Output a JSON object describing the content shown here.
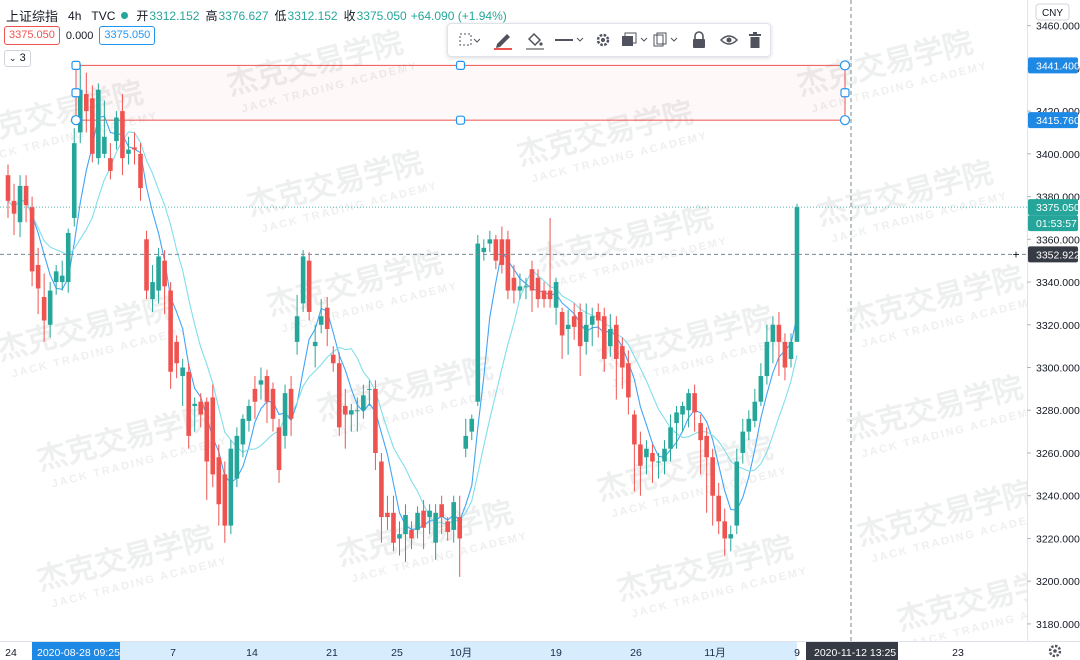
{
  "header": {
    "symbol": "上证综指",
    "interval": "4h",
    "source": "TVC",
    "open_label": "开",
    "open": "3312.152",
    "high_label": "高",
    "high": "3376.627",
    "low_label": "低",
    "low": "3312.152",
    "close_label": "收",
    "close": "3375.050",
    "change": "+64.090 (+1.94%)",
    "price_box": "3375.050",
    "zero_value": "0.000",
    "ma_box": "3375.050",
    "collapse_label": "3"
  },
  "currency": "CNY",
  "y_ticks": [
    "3460.000",
    "3440.000",
    "3420.000",
    "3400.000",
    "3380.000",
    "3360.000",
    "3340.000",
    "3320.000",
    "3300.000",
    "3280.000",
    "3260.000",
    "3240.000",
    "3220.000",
    "3200.000",
    "3180.000"
  ],
  "price_labels": {
    "rect_top": "3441.400",
    "rect_bottom": "3415.760",
    "last_price": "3375.050",
    "countdown": "01:53:57",
    "crosshair_price": "3352.922",
    "crosshair_plus": "+"
  },
  "x_ticks": [
    "24",
    "7",
    "14",
    "21",
    "25",
    "10月",
    "19",
    "26",
    "11月",
    "9",
    "23"
  ],
  "time_labels": {
    "left_date": "2020-08-28",
    "left_time": "09:25",
    "right_date": "2020-11-12",
    "right_time": "13:25"
  },
  "watermark": {
    "cn": "杰克交易学院",
    "en": "JACK TRADING ACADEMY"
  },
  "colors": {
    "up": "#26a69a",
    "down": "#ef5350",
    "ma_fast": "#42a5f5",
    "ma_slow": "#80deea",
    "rect": "#ef5350",
    "accent": "#2196f3"
  },
  "toolbar": {
    "icons": [
      "dashed-square-icon",
      "pencil-icon",
      "paint-bucket-icon",
      "line-style-icon",
      "gear-icon",
      "layers-icon",
      "copy-icon",
      "lock-icon",
      "eye-icon",
      "trash-icon"
    ]
  },
  "chart_data": {
    "type": "candlestick",
    "title": "",
    "ylim": [
      3172,
      3472
    ],
    "rectangle": {
      "top": 3441.4,
      "bottom": 3415.76
    },
    "last_price": 3375.05,
    "crosshair_price": 3352.922,
    "candles": [
      [
        3390,
        3378,
        3395,
        3370
      ],
      [
        3378,
        3372,
        3386,
        3362
      ],
      [
        3368,
        3385,
        3390,
        3361
      ],
      [
        3385,
        3376,
        3390,
        3368
      ],
      [
        3375,
        3345,
        3380,
        3338
      ],
      [
        3348,
        3337,
        3356,
        3325
      ],
      [
        3333,
        3322,
        3344,
        3312
      ],
      [
        3320,
        3336,
        3340,
        3314
      ],
      [
        3340,
        3345,
        3348,
        3334
      ],
      [
        3340,
        3343,
        3350,
        3336
      ],
      [
        3340,
        3363,
        3365,
        3335
      ],
      [
        3370,
        3405,
        3412,
        3366
      ],
      [
        3410,
        3430,
        3442,
        3405
      ],
      [
        3428,
        3420,
        3438,
        3410
      ],
      [
        3426,
        3400,
        3432,
        3396
      ],
      [
        3398,
        3430,
        3433,
        3395
      ],
      [
        3400,
        3408,
        3425,
        3398
      ],
      [
        3398,
        3392,
        3405,
        3388
      ],
      [
        3406,
        3417,
        3420,
        3402
      ],
      [
        3420,
        3398,
        3428,
        3390
      ],
      [
        3400,
        3402,
        3408,
        3395
      ],
      [
        3403,
        3402,
        3410,
        3395
      ],
      [
        3400,
        3384,
        3405,
        3378
      ],
      [
        3360,
        3336,
        3364,
        3332
      ],
      [
        3332,
        3340,
        3348,
        3326
      ],
      [
        3336,
        3352,
        3356,
        3330
      ],
      [
        3350,
        3338,
        3355,
        3325
      ],
      [
        3336,
        3298,
        3340,
        3290
      ],
      [
        3312,
        3302,
        3315,
        3295
      ],
      [
        3296,
        3300,
        3304,
        3282
      ],
      [
        3298,
        3268,
        3302,
        3262
      ],
      [
        3282,
        3283,
        3286,
        3270
      ],
      [
        3284,
        3278,
        3288,
        3272
      ],
      [
        3284,
        3256,
        3286,
        3238
      ],
      [
        3286,
        3250,
        3292,
        3244
      ],
      [
        3258,
        3236,
        3264,
        3226
      ],
      [
        3250,
        3226,
        3256,
        3218
      ],
      [
        3226,
        3262,
        3266,
        3222
      ],
      [
        3248,
        3268,
        3272,
        3244
      ],
      [
        3264,
        3276,
        3278,
        3258
      ],
      [
        3275,
        3282,
        3285,
        3270
      ],
      [
        3290,
        3284,
        3296,
        3276
      ],
      [
        3292,
        3294,
        3300,
        3285
      ],
      [
        3296,
        3284,
        3299,
        3274
      ],
      [
        3290,
        3276,
        3293,
        3270
      ],
      [
        3272,
        3252,
        3276,
        3246
      ],
      [
        3268,
        3288,
        3292,
        3262
      ],
      [
        3290,
        3276,
        3296,
        3268
      ],
      [
        3312,
        3324,
        3334,
        3306
      ],
      [
        3330,
        3352,
        3355,
        3326
      ],
      [
        3350,
        3326,
        3354,
        3322
      ],
      [
        3310,
        3312,
        3320,
        3300
      ],
      [
        3320,
        3324,
        3332,
        3316
      ],
      [
        3328,
        3318,
        3333,
        3310
      ],
      [
        3306,
        3302,
        3310,
        3298
      ],
      [
        3302,
        3272,
        3307,
        3268
      ],
      [
        3282,
        3278,
        3290,
        3262
      ],
      [
        3278,
        3280,
        3283,
        3270
      ],
      [
        3280,
        3280,
        3286,
        3270
      ],
      [
        3280,
        3287,
        3292,
        3276
      ],
      [
        3290,
        3290,
        3294,
        3282
      ],
      [
        3290,
        3260,
        3294,
        3252
      ],
      [
        3256,
        3230,
        3260,
        3218
      ],
      [
        3232,
        3230,
        3240,
        3224
      ],
      [
        3232,
        3218,
        3240,
        3214
      ],
      [
        3220,
        3222,
        3228,
        3212
      ],
      [
        3222,
        3231,
        3236,
        3209
      ],
      [
        3224,
        3220,
        3228,
        3215
      ],
      [
        3224,
        3232,
        3235,
        3220
      ],
      [
        3233,
        3225,
        3238,
        3215
      ],
      [
        3230,
        3233,
        3236,
        3222
      ],
      [
        3218,
        3232,
        3236,
        3210
      ],
      [
        3236,
        3230,
        3240,
        3222
      ],
      [
        3228,
        3223,
        3230,
        3219
      ],
      [
        3224,
        3237,
        3240,
        3218
      ],
      [
        3230,
        3220,
        3240,
        3202
      ],
      [
        3262,
        3268,
        3276,
        3258
      ],
      [
        3270,
        3276,
        3278,
        3266
      ],
      [
        3284,
        3358,
        3362,
        3282
      ],
      [
        3354,
        3356,
        3360,
        3350
      ],
      [
        3358,
        3360,
        3364,
        3354
      ],
      [
        3360,
        3350,
        3362,
        3346
      ],
      [
        3360,
        3348,
        3366,
        3344
      ],
      [
        3360,
        3336,
        3364,
        3332
      ],
      [
        3342,
        3336,
        3348,
        3330
      ],
      [
        3336,
        3338,
        3344,
        3332
      ],
      [
        3338,
        3338,
        3342,
        3332
      ],
      [
        3346,
        3336,
        3350,
        3326
      ],
      [
        3342,
        3332,
        3346,
        3328
      ],
      [
        3336,
        3332,
        3340,
        3328
      ],
      [
        3336,
        3332,
        3370,
        3328
      ],
      [
        3328,
        3340,
        3342,
        3320
      ],
      [
        3326,
        3315,
        3328,
        3304
      ],
      [
        3318,
        3320,
        3327,
        3306
      ],
      [
        3324,
        3319,
        3330,
        3313
      ],
      [
        3326,
        3310,
        3330,
        3296
      ],
      [
        3312,
        3320,
        3330,
        3306
      ],
      [
        3320,
        3324,
        3328,
        3310
      ],
      [
        3326,
        3322,
        3330,
        3314
      ],
      [
        3324,
        3304,
        3328,
        3298
      ],
      [
        3310,
        3318,
        3325,
        3305
      ],
      [
        3320,
        3304,
        3324,
        3285
      ],
      [
        3310,
        3300,
        3314,
        3290
      ],
      [
        3302,
        3286,
        3308,
        3278
      ],
      [
        3278,
        3264,
        3280,
        3242
      ],
      [
        3264,
        3254,
        3270,
        3240
      ],
      [
        3258,
        3262,
        3266,
        3250
      ],
      [
        3260,
        3256,
        3264,
        3246
      ],
      [
        3256,
        3256,
        3260,
        3248
      ],
      [
        3256,
        3262,
        3266,
        3250
      ],
      [
        3262,
        3272,
        3278,
        3256
      ],
      [
        3274,
        3279,
        3282,
        3262
      ],
      [
        3278,
        3282,
        3284,
        3270
      ],
      [
        3280,
        3288,
        3290,
        3272
      ],
      [
        3288,
        3279,
        3292,
        3270
      ],
      [
        3274,
        3266,
        3278,
        3250
      ],
      [
        3268,
        3258,
        3272,
        3232
      ],
      [
        3258,
        3240,
        3262,
        3226
      ],
      [
        3240,
        3228,
        3246,
        3222
      ],
      [
        3228,
        3220,
        3234,
        3212
      ],
      [
        3220,
        3222,
        3226,
        3214
      ],
      [
        3226,
        3256,
        3262,
        3222
      ],
      [
        3260,
        3270,
        3276,
        3255
      ],
      [
        3270,
        3276,
        3280,
        3266
      ],
      [
        3275,
        3284,
        3290,
        3272
      ],
      [
        3284,
        3296,
        3302,
        3282
      ],
      [
        3296,
        3312,
        3320,
        3292
      ],
      [
        3312,
        3320,
        3324,
        3302
      ],
      [
        3320,
        3312,
        3326,
        3296
      ],
      [
        3312,
        3300,
        3316,
        3294
      ],
      [
        3304,
        3312,
        3316,
        3300
      ],
      [
        3312,
        3375.05,
        3376.627,
        3312.152
      ]
    ]
  }
}
